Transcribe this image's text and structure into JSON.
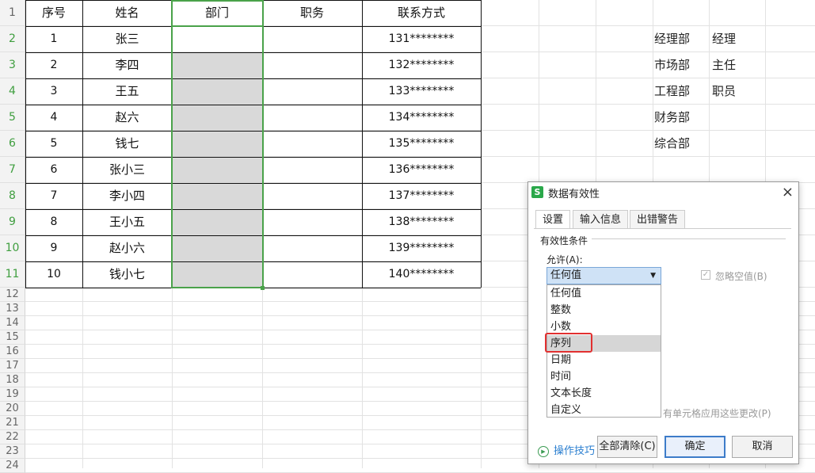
{
  "sheet": {
    "row_numbers": [
      "1",
      "2",
      "3",
      "4",
      "5",
      "6",
      "7",
      "8",
      "9",
      "10",
      "11",
      "12",
      "13",
      "14",
      "15",
      "16",
      "17",
      "18",
      "19",
      "20",
      "21",
      "22",
      "23",
      "24"
    ],
    "headers": [
      "序号",
      "姓名",
      "部门",
      "职务",
      "联系方式"
    ],
    "rows": [
      [
        "1",
        "张三",
        "",
        "",
        "131********"
      ],
      [
        "2",
        "李四",
        "",
        "",
        "132********"
      ],
      [
        "3",
        "王五",
        "",
        "",
        "133********"
      ],
      [
        "4",
        "赵六",
        "",
        "",
        "134********"
      ],
      [
        "5",
        "钱七",
        "",
        "",
        "135********"
      ],
      [
        "6",
        "张小三",
        "",
        "",
        "136********"
      ],
      [
        "7",
        "李小四",
        "",
        "",
        "137********"
      ],
      [
        "8",
        "王小五",
        "",
        "",
        "138********"
      ],
      [
        "9",
        "赵小六",
        "",
        "",
        "139********"
      ],
      [
        "10",
        "钱小七",
        "",
        "",
        "140********"
      ]
    ],
    "side_departments": [
      "经理部",
      "市场部",
      "工程部",
      "财务部",
      "综合部"
    ],
    "side_positions": [
      "经理",
      "主任",
      "职员"
    ]
  },
  "dialog": {
    "title": "数据有效性",
    "close": "×",
    "tabs": [
      "设置",
      "输入信息",
      "出错警告"
    ],
    "section_label": "有效性条件",
    "allow_label": "允许(A):",
    "allow_value": "任何值",
    "ignore_blank": "忽略空值(B)",
    "apply_all": "有单元格应用这些更改(P)",
    "options": [
      "任何值",
      "整数",
      "小数",
      "序列",
      "日期",
      "时间",
      "文本长度",
      "自定义"
    ],
    "tips": "操作技巧",
    "buttons": {
      "clear": "全部清除(C)",
      "ok": "确定",
      "cancel": "取消"
    }
  }
}
